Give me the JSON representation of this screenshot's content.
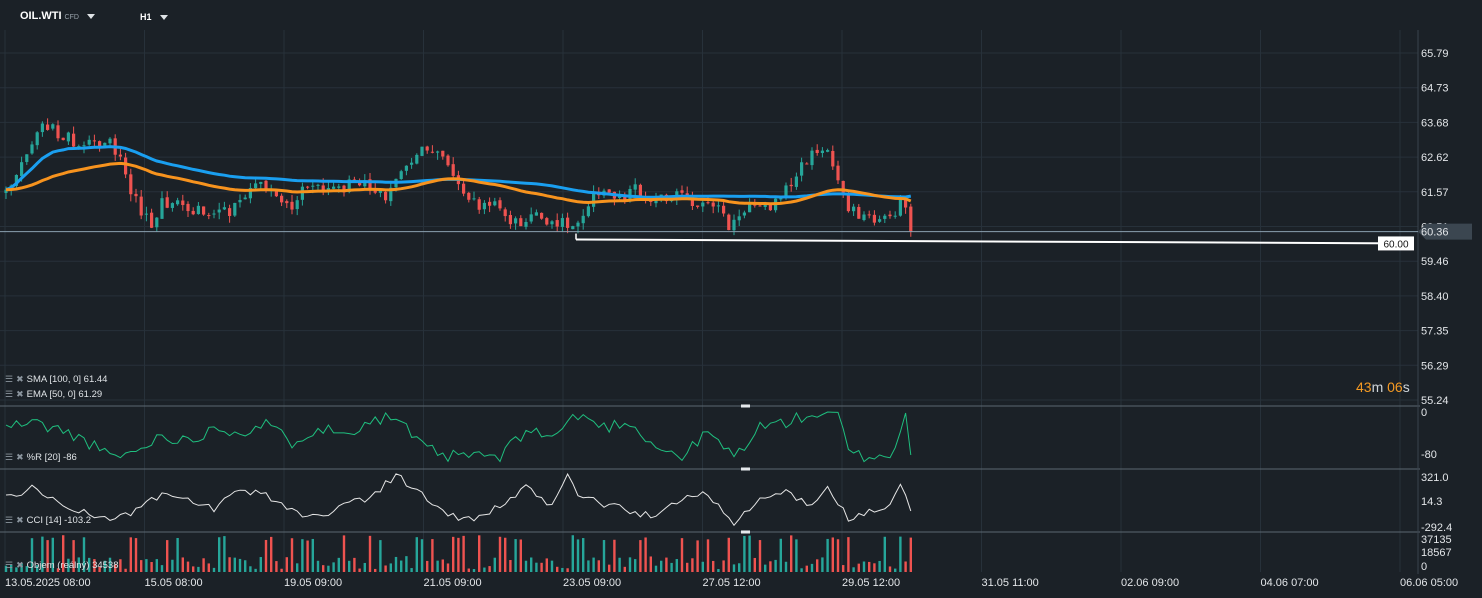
{
  "header": {
    "symbol": "OIL.WTI",
    "symbol_type": "CFD",
    "timeframe": "H1"
  },
  "indicators": {
    "sma": "SMA [100, 0] 61.44",
    "ema": "EMA [50, 0] 61.29",
    "williams_r": "%R [20] -86",
    "cci": "CCI [14] -103.2",
    "volume": "Objem (reálný) 34538"
  },
  "countdown": {
    "minutes": "43",
    "minutes_unit": "m",
    "seconds": "06",
    "seconds_unit": "s"
  },
  "colors": {
    "background": "#1b2127",
    "grid": "#27313a",
    "bull": "#26a69a",
    "bear": "#ef5350",
    "sma": "#1a9ff0",
    "ema": "#f7931e",
    "willr": "#1fbf7f",
    "cci": "#e6e6e6",
    "price_line": "#8aa0b0",
    "level_line": "#ffffff",
    "countdown": "#f59a23"
  },
  "chart_data": [
    {
      "type": "candlestick",
      "title": "OIL.WTI",
      "timeframe": "H1",
      "y_ticks": [
        "65.79",
        "64.73",
        "63.68",
        "62.62",
        "61.57",
        "60.51",
        "59.46",
        "58.40",
        "57.35",
        "56.29",
        "55.24"
      ],
      "ylim": [
        55.24,
        65.79
      ],
      "x_ticks": [
        "13.05.2025  08:00",
        "15.05  08:00",
        "19.05  09:00",
        "21.05  09:00",
        "23.05  09:00",
        "27.05  12:00",
        "29.05  12:00",
        "31.05  11:00",
        "02.06  09:00",
        "04.06  07:00",
        "06.06  05:00"
      ],
      "close_path": [
        [
          0,
          61.6
        ],
        [
          3,
          62.3
        ],
        [
          5,
          63.0
        ],
        [
          7,
          63.5
        ],
        [
          8,
          63.6
        ],
        [
          10,
          63.3
        ],
        [
          12,
          63.2
        ],
        [
          14,
          63.0
        ],
        [
          16,
          63.3
        ],
        [
          18,
          62.8
        ],
        [
          20,
          63.1
        ],
        [
          22,
          62.6
        ],
        [
          24,
          61.6
        ],
        [
          26,
          61.0
        ],
        [
          28,
          60.6
        ],
        [
          30,
          61.3
        ],
        [
          31,
          61.0
        ],
        [
          33,
          61.2
        ],
        [
          35,
          60.9
        ],
        [
          37,
          61.2
        ],
        [
          39,
          60.8
        ],
        [
          41,
          61.1
        ],
        [
          43,
          60.9
        ],
        [
          45,
          61.3
        ],
        [
          47,
          61.7
        ],
        [
          49,
          61.9
        ],
        [
          51,
          61.5
        ],
        [
          53,
          61.3
        ],
        [
          55,
          61.0
        ],
        [
          57,
          61.7
        ],
        [
          59,
          61.9
        ],
        [
          61,
          61.6
        ],
        [
          63,
          61.8
        ],
        [
          65,
          61.7
        ],
        [
          67,
          62.0
        ],
        [
          69,
          61.8
        ],
        [
          71,
          61.5
        ],
        [
          73,
          61.4
        ],
        [
          75,
          62.0
        ],
        [
          77,
          62.3
        ],
        [
          79,
          62.8
        ],
        [
          81,
          63.0
        ],
        [
          83,
          62.7
        ],
        [
          85,
          62.4
        ],
        [
          87,
          61.8
        ],
        [
          89,
          61.4
        ],
        [
          91,
          61.1
        ],
        [
          93,
          61.3
        ],
        [
          95,
          61.0
        ],
        [
          97,
          60.7
        ],
        [
          99,
          60.6
        ],
        [
          101,
          60.9
        ],
        [
          103,
          60.8
        ],
        [
          105,
          60.7
        ],
        [
          107,
          60.6
        ],
        [
          109,
          60.5
        ],
        [
          111,
          60.7
        ],
        [
          113,
          61.4
        ],
        [
          115,
          61.7
        ],
        [
          117,
          61.4
        ],
        [
          119,
          61.3
        ],
        [
          121,
          61.7
        ],
        [
          123,
          61.2
        ],
        [
          125,
          61.4
        ],
        [
          127,
          61.3
        ],
        [
          129,
          61.5
        ],
        [
          131,
          61.3
        ],
        [
          133,
          61.2
        ],
        [
          135,
          61.4
        ],
        [
          137,
          61.1
        ],
        [
          139,
          60.5
        ],
        [
          141,
          60.9
        ],
        [
          143,
          61.2
        ],
        [
          145,
          61.0
        ],
        [
          147,
          61.1
        ],
        [
          149,
          61.5
        ],
        [
          151,
          61.8
        ],
        [
          153,
          62.4
        ],
        [
          155,
          62.7
        ],
        [
          157,
          62.9
        ],
        [
          158,
          62.8
        ],
        [
          160,
          61.9
        ],
        [
          161,
          61.4
        ],
        [
          162,
          61.0
        ],
        [
          164,
          60.9
        ],
        [
          166,
          60.8
        ],
        [
          168,
          60.7
        ],
        [
          170,
          60.8
        ],
        [
          172,
          61.2
        ],
        [
          173,
          61.1
        ],
        [
          174,
          60.36
        ]
      ],
      "sma_100_last": 61.44,
      "ema_50_last": 61.29,
      "last_price": 60.36,
      "last_price_label": "60.36",
      "horizontal_level": 60.0,
      "horizontal_level_label": "60.00"
    },
    {
      "type": "line",
      "title": "%R [20]",
      "y_ticks": [
        "0",
        "-80"
      ],
      "ylim": [
        -100,
        0
      ],
      "last": -86,
      "path": [
        [
          0,
          -30
        ],
        [
          5,
          -20
        ],
        [
          10,
          -35
        ],
        [
          15,
          -55
        ],
        [
          20,
          -90
        ],
        [
          25,
          -80
        ],
        [
          30,
          -45
        ],
        [
          35,
          -60
        ],
        [
          40,
          -30
        ],
        [
          45,
          -40
        ],
        [
          50,
          -25
        ],
        [
          55,
          -60
        ],
        [
          60,
          -30
        ],
        [
          65,
          -45
        ],
        [
          70,
          -15
        ],
        [
          75,
          -10
        ],
        [
          80,
          -70
        ],
        [
          85,
          -90
        ],
        [
          90,
          -85
        ],
        [
          95,
          -92
        ],
        [
          100,
          -35
        ],
        [
          105,
          -50
        ],
        [
          110,
          -5
        ],
        [
          115,
          -30
        ],
        [
          120,
          -20
        ],
        [
          125,
          -70
        ],
        [
          130,
          -90
        ],
        [
          135,
          -40
        ],
        [
          140,
          -90
        ],
        [
          145,
          -30
        ],
        [
          150,
          -20
        ],
        [
          155,
          -5
        ],
        [
          160,
          -5
        ],
        [
          162,
          -80
        ],
        [
          165,
          -90
        ],
        [
          168,
          -85
        ],
        [
          170,
          -92
        ],
        [
          172,
          -40
        ],
        [
          173,
          -5
        ],
        [
          174,
          -86
        ]
      ]
    },
    {
      "type": "line",
      "title": "CCI [14]",
      "y_ticks": [
        "321.0",
        "14.3",
        "-292.4"
      ],
      "ylim": [
        -292.4,
        321.0
      ],
      "last": -103.2,
      "path": [
        [
          0,
          50
        ],
        [
          5,
          150
        ],
        [
          10,
          0
        ],
        [
          15,
          -120
        ],
        [
          20,
          -200
        ],
        [
          25,
          -100
        ],
        [
          30,
          80
        ],
        [
          35,
          10
        ],
        [
          40,
          -80
        ],
        [
          45,
          120
        ],
        [
          50,
          80
        ],
        [
          55,
          -100
        ],
        [
          60,
          -180
        ],
        [
          65,
          -20
        ],
        [
          70,
          50
        ],
        [
          75,
          300
        ],
        [
          80,
          80
        ],
        [
          85,
          -150
        ],
        [
          90,
          -200
        ],
        [
          95,
          -50
        ],
        [
          100,
          150
        ],
        [
          105,
          -50
        ],
        [
          108,
          321
        ],
        [
          110,
          80
        ],
        [
          115,
          -30
        ],
        [
          120,
          -100
        ],
        [
          125,
          -180
        ],
        [
          130,
          50
        ],
        [
          135,
          100
        ],
        [
          140,
          -250
        ],
        [
          145,
          20
        ],
        [
          150,
          120
        ],
        [
          155,
          -60
        ],
        [
          158,
          180
        ],
        [
          162,
          -200
        ],
        [
          165,
          -120
        ],
        [
          170,
          -60
        ],
        [
          172,
          200
        ],
        [
          174,
          -103.2
        ]
      ]
    },
    {
      "type": "bar",
      "title": "Objem (reálný)",
      "y_ticks": [
        "37135",
        "18567",
        "0"
      ],
      "ylim": [
        0,
        37135
      ],
      "last": 34538
    }
  ]
}
